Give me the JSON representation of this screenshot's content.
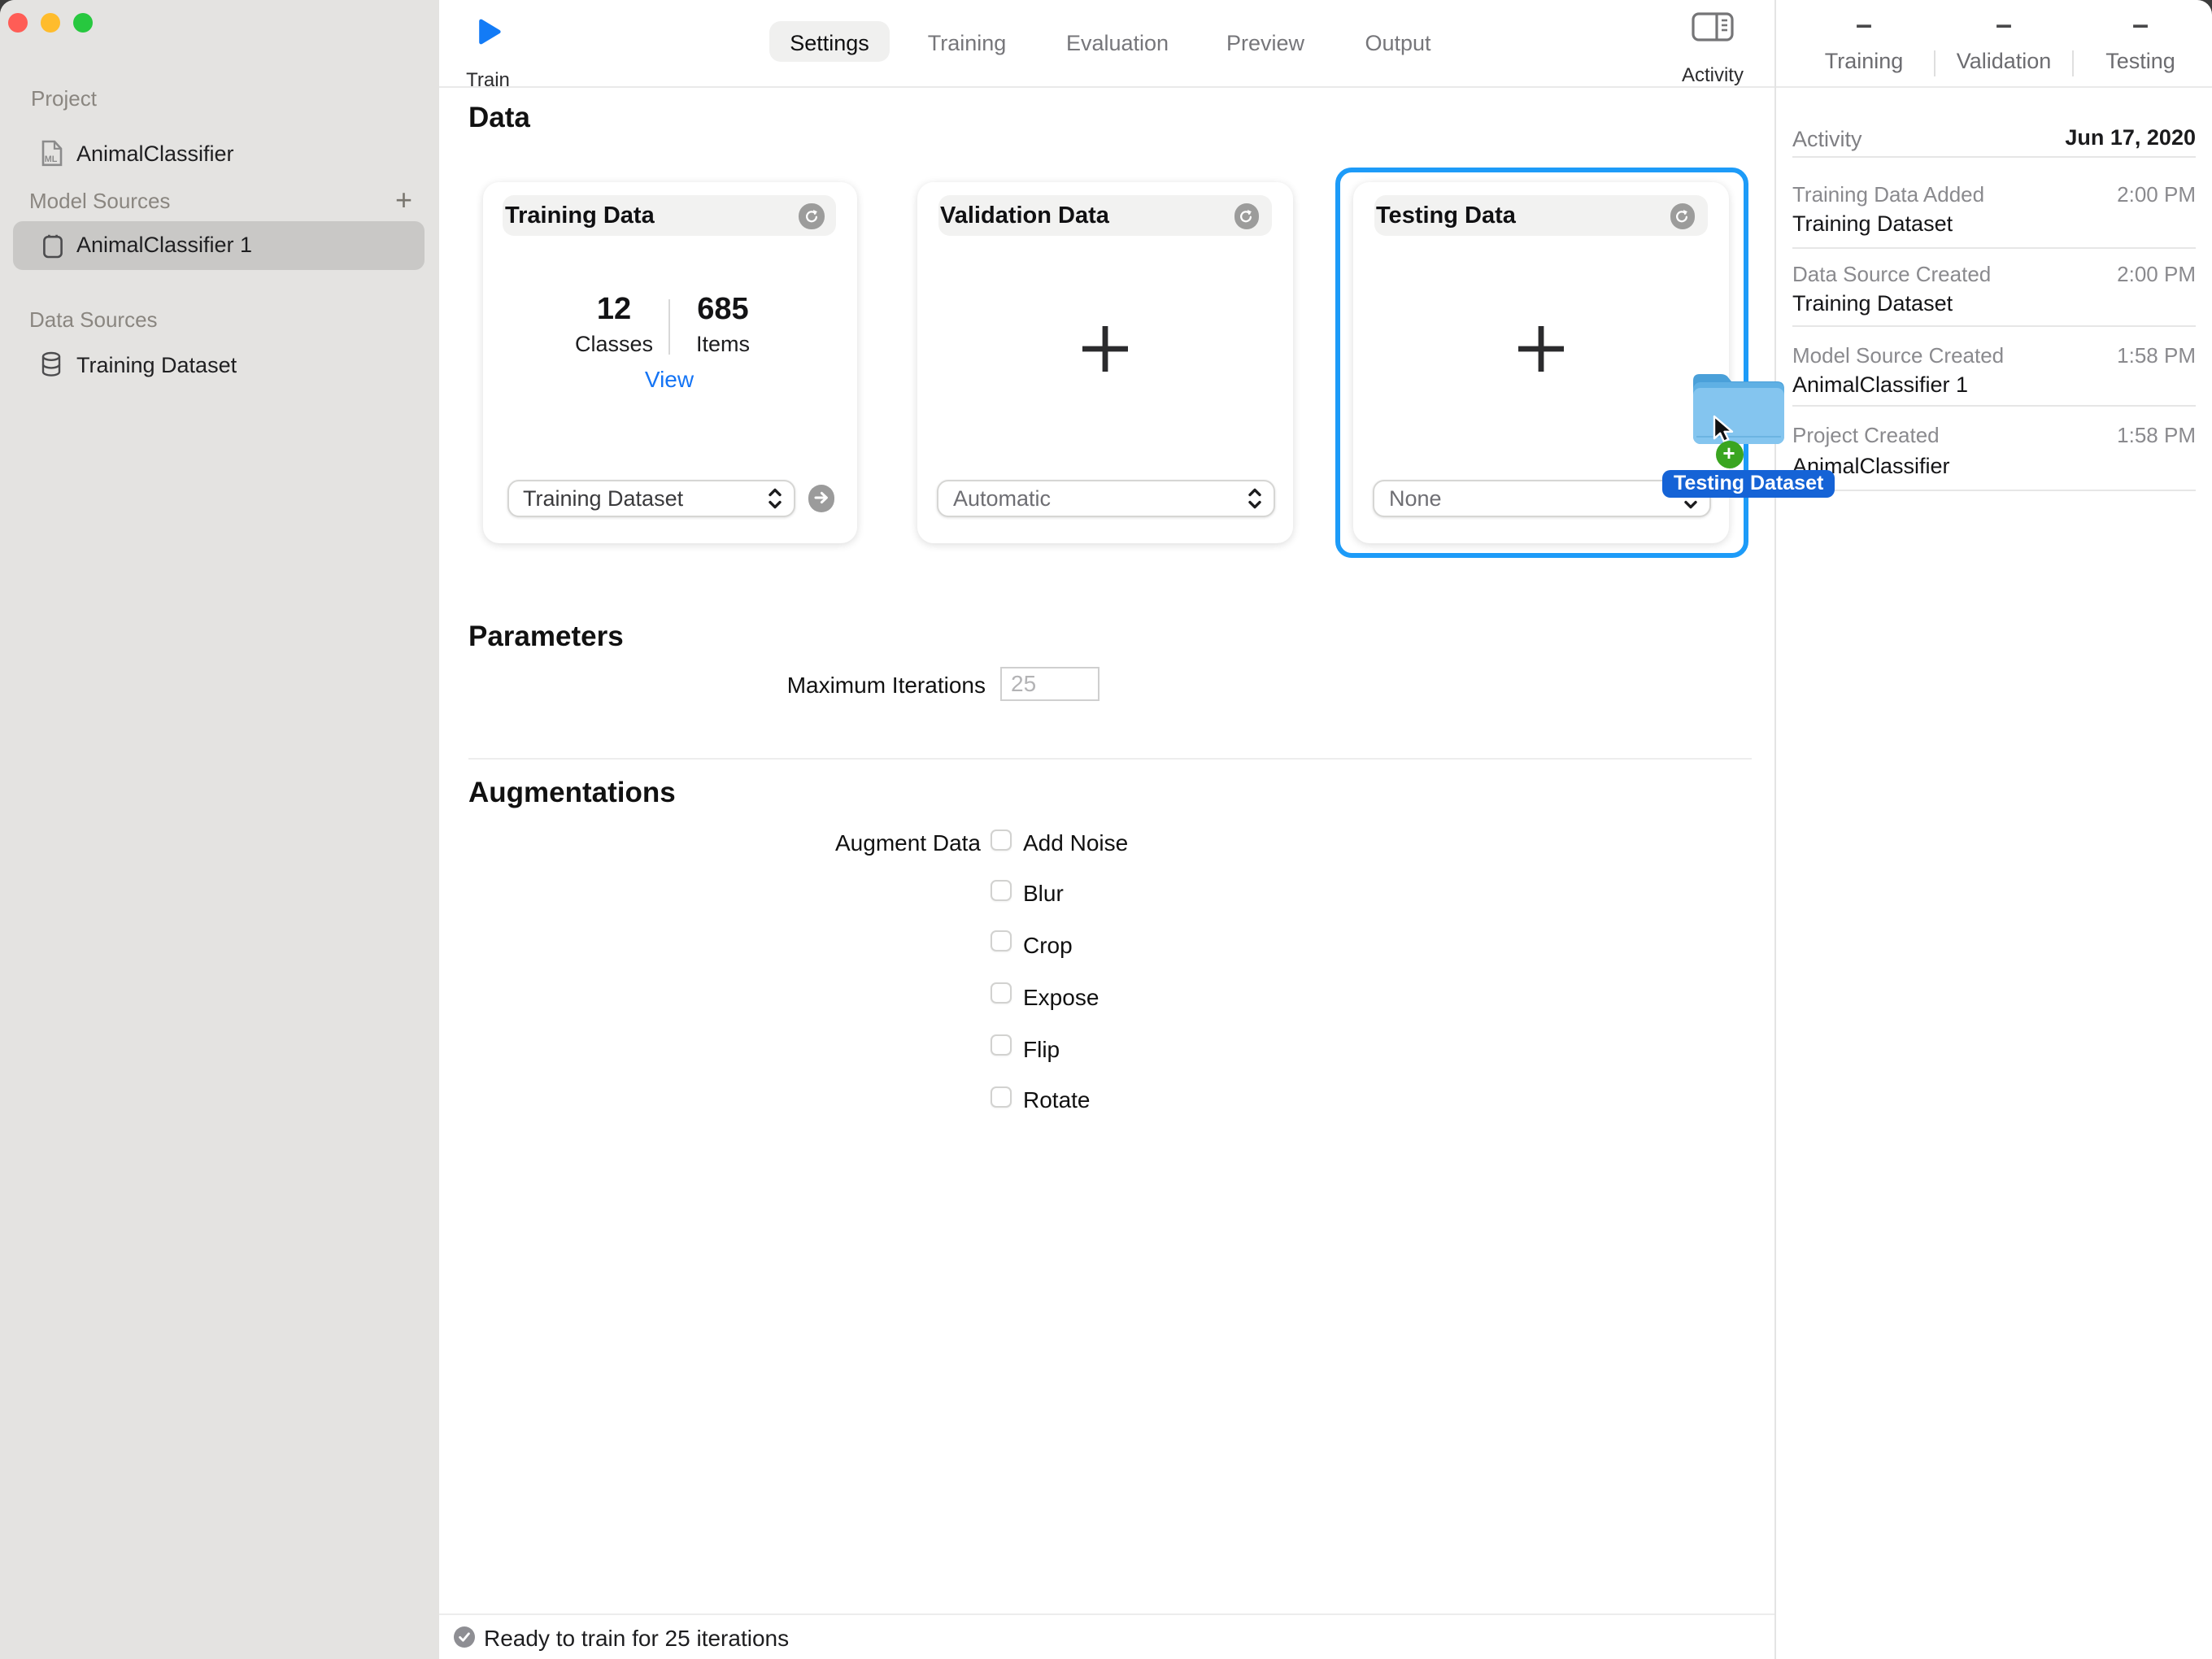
{
  "window": {
    "traffic_lights": {
      "close": "#ff5d56",
      "minimize": "#ffbc2c",
      "zoom": "#27c83f"
    }
  },
  "sidebar": {
    "project_header": "Project",
    "project_item": {
      "icon": "ml-document",
      "label": "AnimalClassifier"
    },
    "model_header": "Model Sources",
    "model_add_button": "+",
    "model_item": {
      "icon": "model-box",
      "label": "AnimalClassifier 1",
      "selected": true
    },
    "data_header": "Data Sources",
    "data_item": {
      "icon": "database-cylinder",
      "label": "Training Dataset"
    }
  },
  "toolbar": {
    "train_label": "Train",
    "tabs": [
      {
        "label": "Settings",
        "active": true
      },
      {
        "label": "Training",
        "active": false
      },
      {
        "label": "Evaluation",
        "active": false
      },
      {
        "label": "Preview",
        "active": false
      },
      {
        "label": "Output",
        "active": false
      }
    ],
    "activity_label": "Activity"
  },
  "metrics": {
    "columns": [
      {
        "value": "–",
        "label": "Training"
      },
      {
        "value": "–",
        "label": "Validation"
      },
      {
        "value": "–",
        "label": "Testing"
      }
    ]
  },
  "activity": {
    "title": "Activity",
    "date": "Jun 17, 2020",
    "events": [
      {
        "title": "Training Data Added",
        "time": "2:00 PM",
        "subject": "Training Dataset"
      },
      {
        "title": "Data Source Created",
        "time": "2:00 PM",
        "subject": "Training Dataset"
      },
      {
        "title": "Model Source Created",
        "time": "1:58 PM",
        "subject": "AnimalClassifier 1"
      },
      {
        "title": "Project Created",
        "time": "1:58 PM",
        "subject": "AnimalClassifier"
      }
    ]
  },
  "data_section": {
    "heading": "Data",
    "cards": [
      {
        "title": "Training Data",
        "icon": "refresh-icon",
        "stat1_value": "12",
        "stat1_label": "Classes",
        "stat2_value": "685",
        "stat2_label": "Items",
        "view_label": "View",
        "dropdown_value": "Training Dataset",
        "has_arrow_button": true
      },
      {
        "title": "Validation Data",
        "icon": "refresh-icon",
        "center_icon": "plus-icon",
        "dropdown_value": "Automatic"
      },
      {
        "title": "Testing Data",
        "icon": "refresh-icon",
        "center_icon": "plus-icon",
        "dropdown_value": "None",
        "selected_drop_target": true
      }
    ]
  },
  "drag_overlay": {
    "folder_icon": "blue-folder",
    "cursor_icon": "pointer-arrow",
    "badge_icon": "green-plus-badge",
    "tooltip": "Testing Dataset"
  },
  "parameters": {
    "heading": "Parameters",
    "iterations_label": "Maximum Iterations",
    "iterations_value": "25"
  },
  "augmentations": {
    "heading": "Augmentations",
    "group_label": "Augment Data",
    "options": [
      "Add Noise",
      "Blur",
      "Crop",
      "Expose",
      "Flip",
      "Rotate"
    ]
  },
  "status_bar": {
    "icon": "checkmark-circle",
    "message": "Ready to train for 25 iterations"
  },
  "colors": {
    "accent_blue": "#147bfb",
    "selection_ring_blue": "#1d9bf8",
    "tooltip_blue": "#1563d6",
    "badge_green": "#3aa520",
    "folder_blue": "#84c5ef",
    "folder_tab_blue": "#4aa0d9",
    "sidebar_bg": "#e4e3e1",
    "selected_row_gray": "#c9c8c6"
  }
}
